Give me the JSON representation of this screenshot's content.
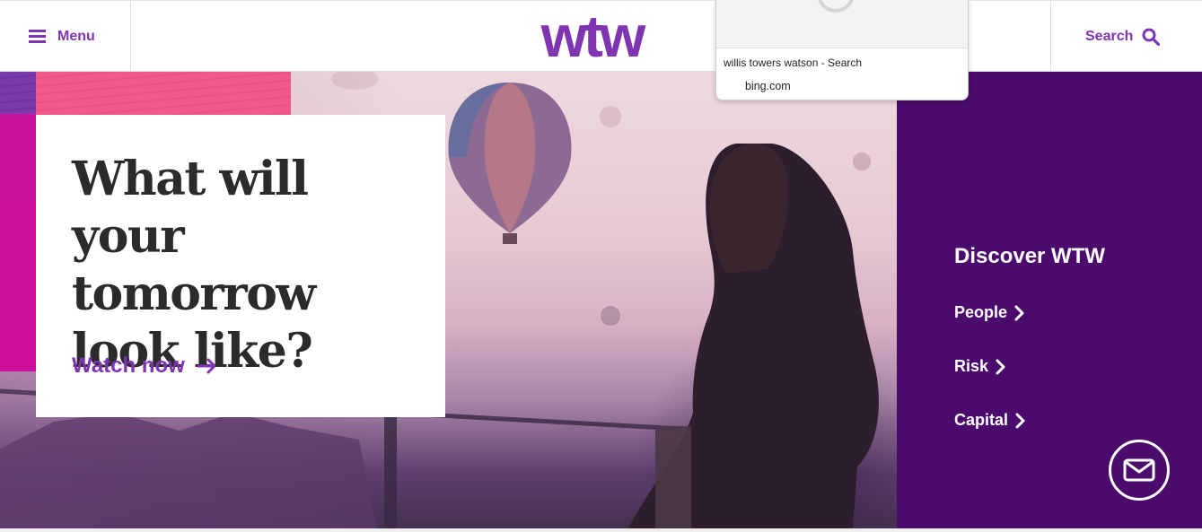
{
  "header": {
    "menu_label": "Menu",
    "search_label": "Search",
    "logo_text": "wtw",
    "icons": {
      "menu": "hamburger-icon",
      "search": "search-icon"
    }
  },
  "hero": {
    "title": "What will your tomorrow look like?",
    "cta_label": "Watch now",
    "cta_icon": "arrow-right-icon"
  },
  "discover": {
    "title": "Discover WTW",
    "links": [
      {
        "label": "People",
        "icon": "chevron-right-icon"
      },
      {
        "label": "Risk",
        "icon": "chevron-right-icon"
      },
      {
        "label": "Capital",
        "icon": "chevron-right-icon"
      }
    ],
    "contact_icon": "mail-icon"
  },
  "autocomplete": {
    "query": "willis towers watson - Search",
    "source": "bing.com"
  },
  "colors": {
    "brand_purple": "#7f35b2",
    "panel_purple": "#4b0b6c",
    "accent_pink": "#f05a8a",
    "accent_magenta": "#cc0e9b"
  }
}
